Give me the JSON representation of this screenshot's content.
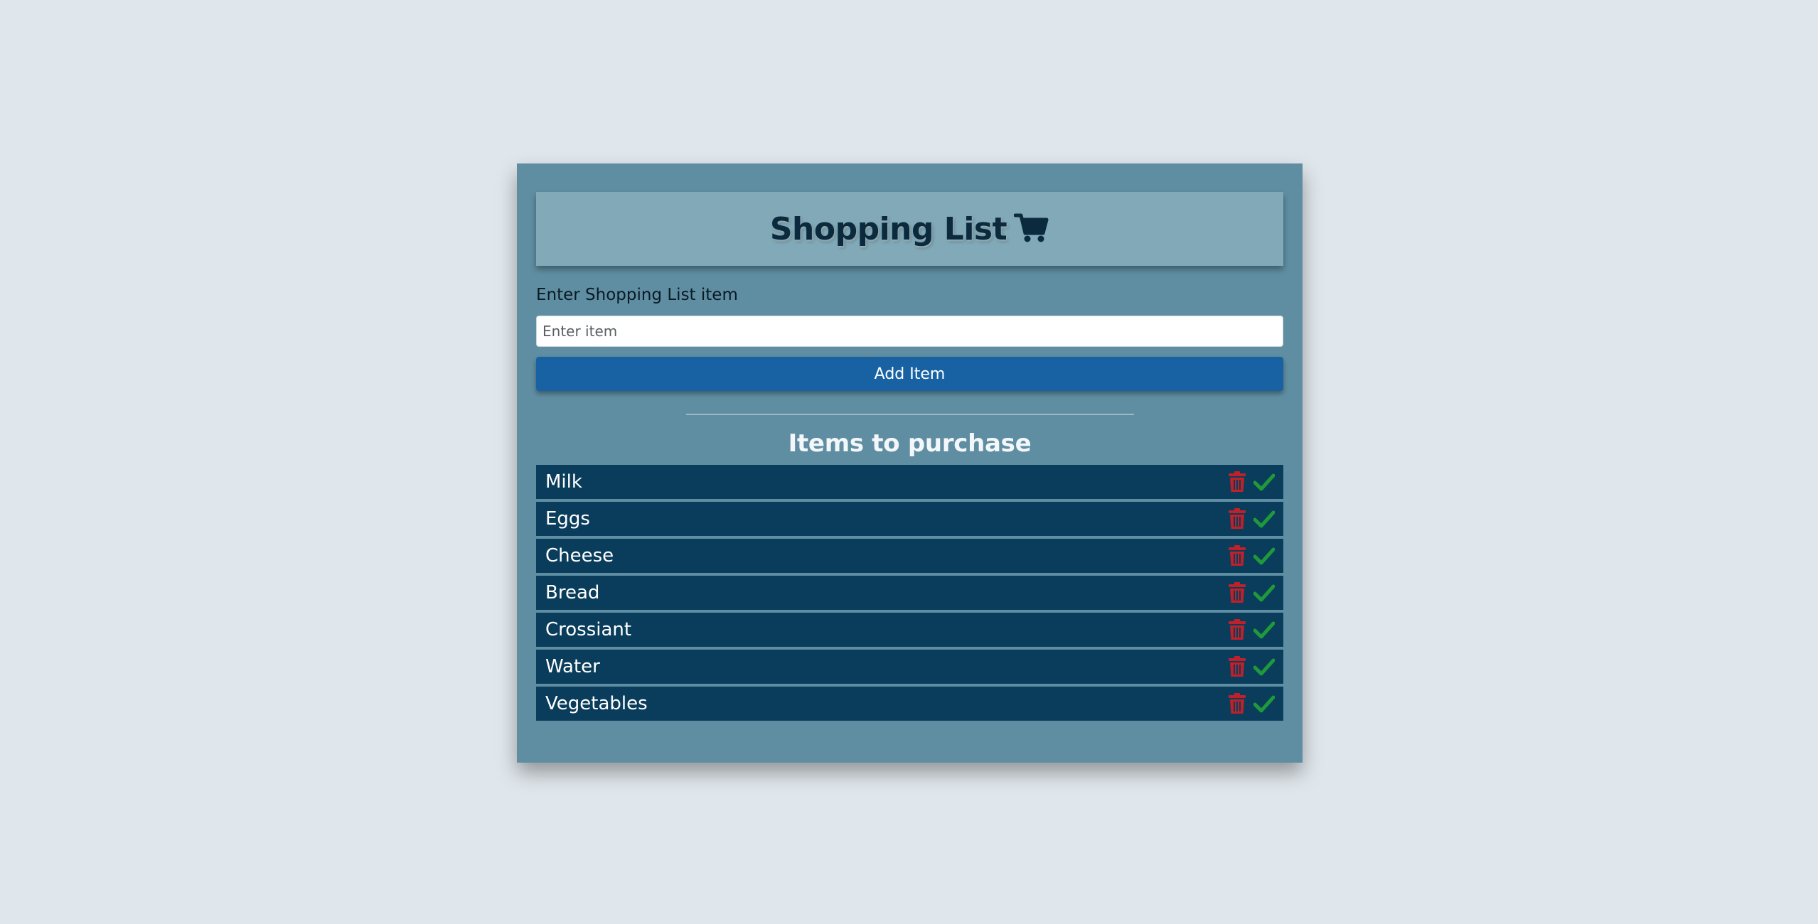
{
  "header": {
    "title": "Shopping List",
    "icon": "shopping-cart-icon"
  },
  "form": {
    "label": "Enter Shopping List item",
    "input_value": "",
    "input_placeholder": "Enter item",
    "add_button_label": "Add Item"
  },
  "list": {
    "title": "Items to purchase",
    "items": [
      {
        "label": "Milk"
      },
      {
        "label": "Eggs"
      },
      {
        "label": "Cheese"
      },
      {
        "label": "Bread"
      },
      {
        "label": "Crossiant"
      },
      {
        "label": "Water"
      },
      {
        "label": "Vegetables"
      }
    ],
    "delete_icon": "trash-icon",
    "done_icon": "check-icon"
  },
  "colors": {
    "page_bg": "#e0e7ec",
    "card_bg": "#5f8ea2",
    "header_bg": "#81a9b7",
    "title_text": "#0b2a3e",
    "button_bg": "#1862a4",
    "item_bg": "#0a3d5b",
    "delete_red": "#c0202a",
    "check_green": "#1e9a3a"
  }
}
